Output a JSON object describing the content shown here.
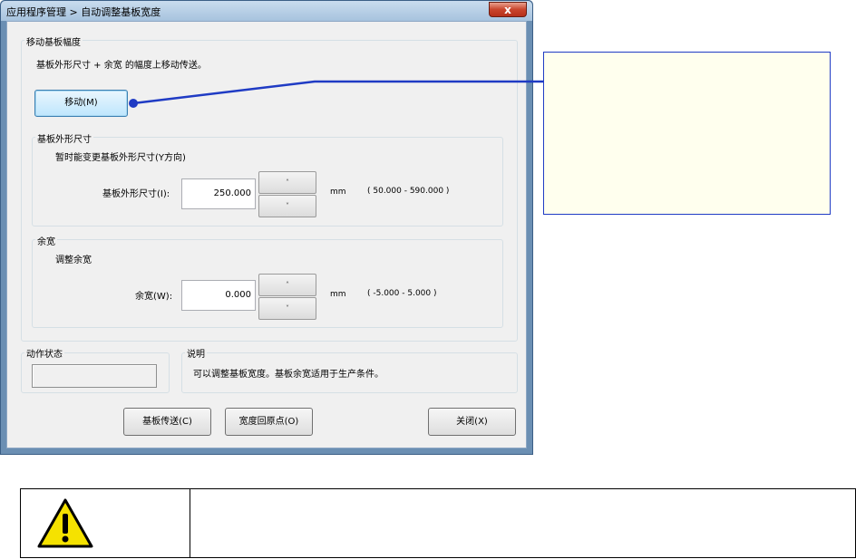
{
  "window": {
    "title": "应用程序管理 > 自动调整基板宽度",
    "close_label": "x"
  },
  "move_group": {
    "title": "移动基板幅度",
    "description": "基板外形尺寸 + 余宽 的幅度上移动传送。",
    "move_button": "移动(M)"
  },
  "size_group": {
    "title": "基板外形尺寸",
    "subtitle": "暂时能变更基板外形尺寸(Y方向)",
    "field_label": "基板外形尺寸(I):",
    "value": "250.000",
    "unit": "mm",
    "range": "( 50.000 - 590.000 )",
    "spin_up": "˄",
    "spin_down": "˅"
  },
  "margin_group": {
    "title": "余宽",
    "subtitle": "调整余宽",
    "field_label": "余宽(W):",
    "value": "0.000",
    "unit": "mm",
    "range": "( -5.000 - 5.000 )",
    "spin_up": "˄",
    "spin_down": "˅"
  },
  "status_group": {
    "title": "动作状态",
    "value": ""
  },
  "info_group": {
    "title": "说明",
    "text": "可以调整基板宽度。基板余宽适用于生产条件。"
  },
  "buttons": {
    "transfer": "基板传送(C)",
    "origin": "宽度回原点(O)",
    "close": "关闭(X)"
  },
  "colors": {
    "callout_border": "#1f3bc4",
    "callout_fill": "#ffffee",
    "warning_yellow": "#f5e200"
  },
  "icons": {
    "caution": "warning-triangle-icon"
  }
}
